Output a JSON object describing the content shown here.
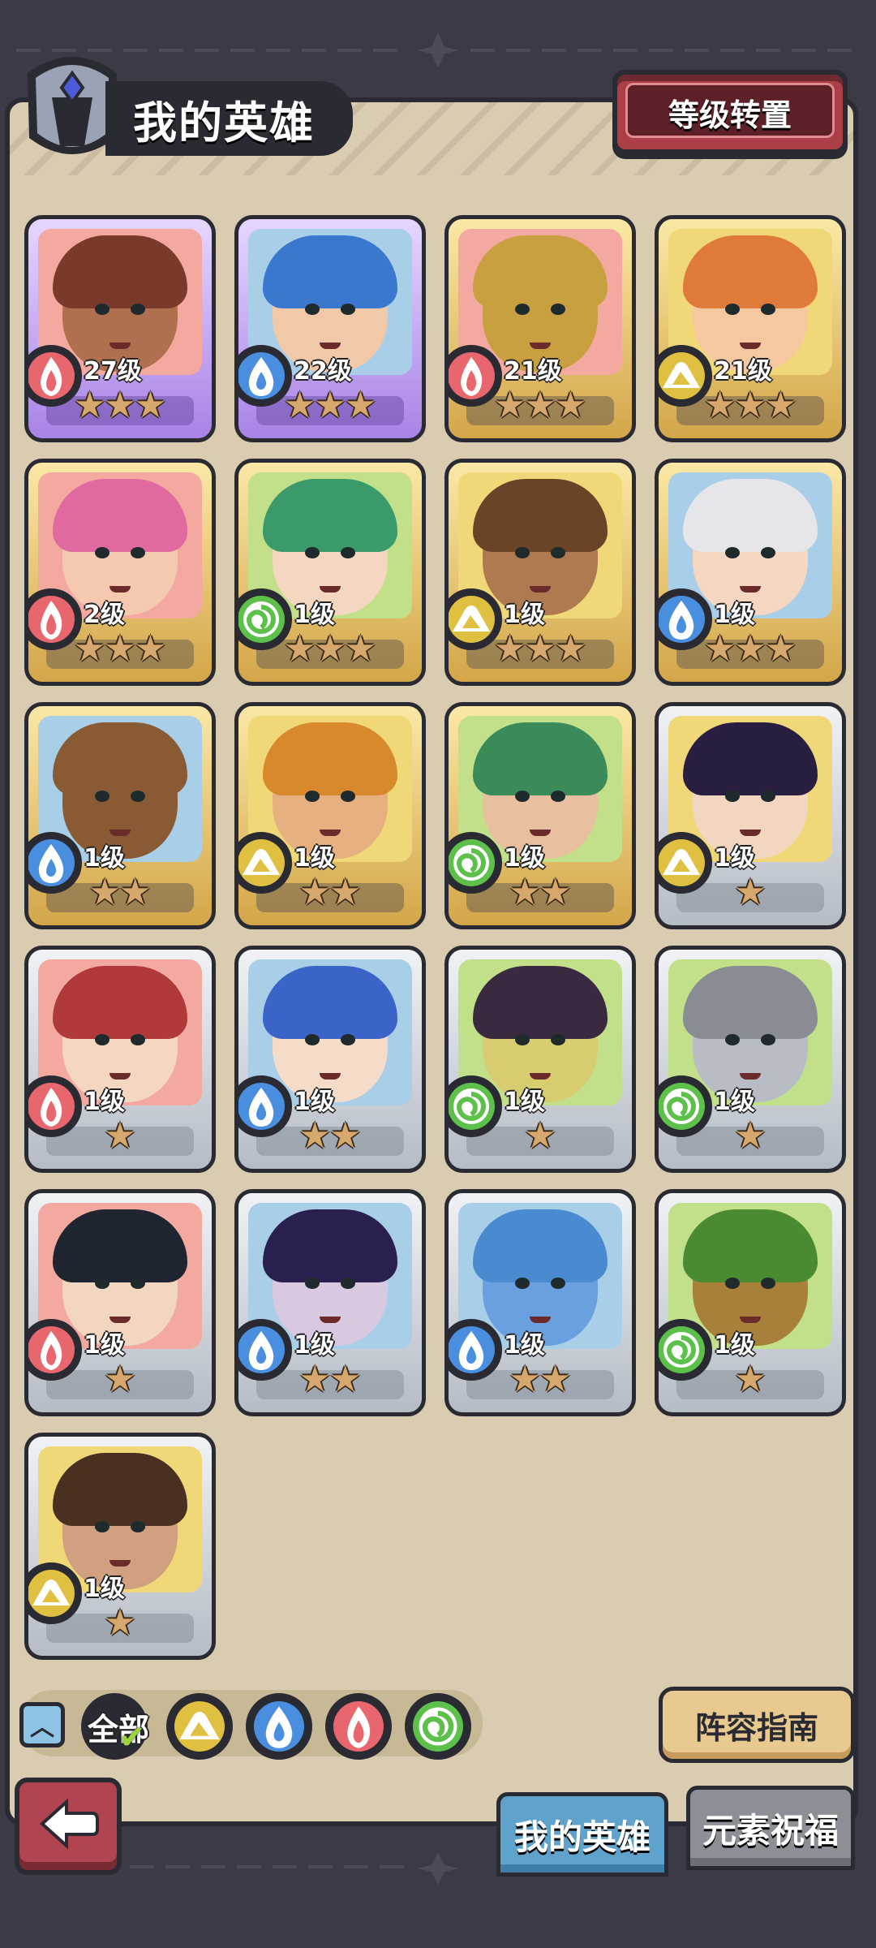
{
  "header": {
    "title": "我的英雄",
    "level_transfer_label": "等级转置"
  },
  "heroes": [
    {
      "level": "27级",
      "stars": 3,
      "element": "fire",
      "rarity": "purple",
      "hair": "#7a3a2a",
      "skin": "#b07050"
    },
    {
      "level": "22级",
      "stars": 3,
      "element": "water",
      "rarity": "purple",
      "hair": "#3a78d0",
      "skin": "#f2c9a8"
    },
    {
      "level": "21级",
      "stars": 3,
      "element": "fire",
      "rarity": "gold",
      "hair": "#c9a040",
      "skin": "#c9a040"
    },
    {
      "level": "21级",
      "stars": 3,
      "element": "earth",
      "rarity": "gold",
      "hair": "#e07a3a",
      "skin": "#f5c8a0"
    },
    {
      "level": "2级",
      "stars": 3,
      "element": "fire",
      "rarity": "gold",
      "hair": "#e06aa0",
      "skin": "#f5c8b0"
    },
    {
      "level": "1级",
      "stars": 3,
      "element": "wind",
      "rarity": "gold",
      "hair": "#3a9a6a",
      "skin": "#f5d6c0"
    },
    {
      "level": "1级",
      "stars": 3,
      "element": "earth",
      "rarity": "gold",
      "hair": "#6b4428",
      "skin": "#b07a50"
    },
    {
      "level": "1级",
      "stars": 3,
      "element": "water",
      "rarity": "gold",
      "hair": "#e6e6ea",
      "skin": "#f5d6c0"
    },
    {
      "level": "1级",
      "stars": 2,
      "element": "water",
      "rarity": "gold",
      "hair": "#8a5a34",
      "skin": "#8a5a34"
    },
    {
      "level": "1级",
      "stars": 2,
      "element": "earth",
      "rarity": "gold",
      "hair": "#d8892c",
      "skin": "#e6b080"
    },
    {
      "level": "1级",
      "stars": 2,
      "element": "wind",
      "rarity": "gold",
      "hair": "#3a8a5a",
      "skin": "#e8c0a0"
    },
    {
      "level": "1级",
      "stars": 1,
      "element": "earth",
      "rarity": "silver",
      "hair": "#2a1e40",
      "skin": "#f2d6c0"
    },
    {
      "level": "1级",
      "stars": 1,
      "element": "fire",
      "rarity": "silver",
      "hair": "#b03a3a",
      "skin": "#f5d6c0"
    },
    {
      "level": "1级",
      "stars": 2,
      "element": "water",
      "rarity": "silver",
      "hair": "#3a64c8",
      "skin": "#f5dcc8"
    },
    {
      "level": "1级",
      "stars": 1,
      "element": "wind",
      "rarity": "silver",
      "hair": "#3a2a40",
      "skin": "#d8cc70"
    },
    {
      "level": "1级",
      "stars": 1,
      "element": "wind",
      "rarity": "silver",
      "hair": "#8a8c94",
      "skin": "#b8bcc4"
    },
    {
      "level": "1级",
      "stars": 1,
      "element": "fire",
      "rarity": "silver",
      "hair": "#1e2430",
      "skin": "#f2d6c0"
    },
    {
      "level": "1级",
      "stars": 2,
      "element": "water",
      "rarity": "silver",
      "hair": "#2a2050",
      "skin": "#d8c8e0"
    },
    {
      "level": "1级",
      "stars": 2,
      "element": "water",
      "rarity": "silver",
      "hair": "#4a8ad0",
      "skin": "#6aa0e0"
    },
    {
      "level": "1级",
      "stars": 1,
      "element": "wind",
      "rarity": "silver",
      "hair": "#4a8a30",
      "skin": "#a8803a"
    },
    {
      "level": "1级",
      "stars": 1,
      "element": "earth",
      "rarity": "silver",
      "hair": "#4a3020",
      "skin": "#d0a080"
    }
  ],
  "filters": {
    "all_label": "全部",
    "elements": [
      "earth",
      "water",
      "fire",
      "wind"
    ]
  },
  "footer": {
    "guide_label": "阵容指南",
    "tab_my_heroes": "我的英雄",
    "tab_elements": "元素祝福"
  },
  "colors": {
    "fire": "#e8666e",
    "water": "#4a8ee0",
    "earth": "#e0c040",
    "wind": "#5cc04a"
  }
}
